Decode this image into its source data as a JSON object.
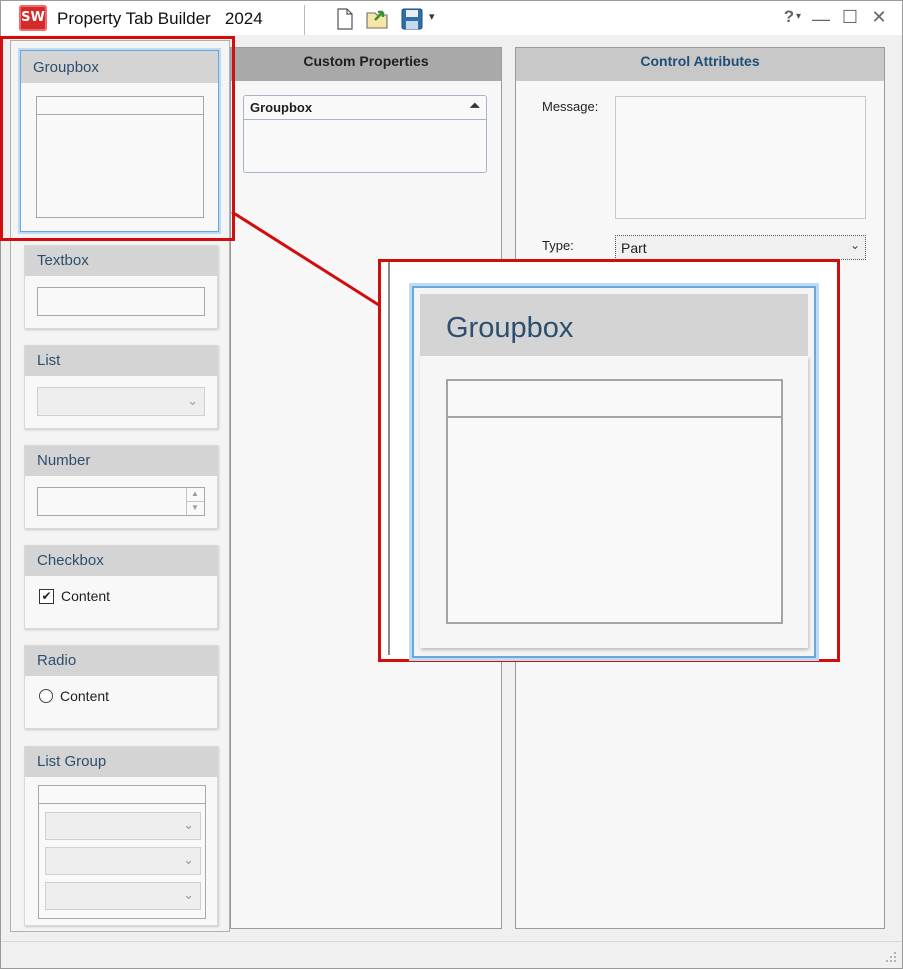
{
  "app": {
    "title": "Property Tab Builder",
    "version": "2024",
    "logo_text": "SW",
    "help_label": "?",
    "help_dropdown": "▾",
    "save_dropdown": "▾",
    "minimize": "—",
    "maximize": "☐",
    "close": "✕"
  },
  "palette": {
    "groupbox": {
      "label": "Groupbox"
    },
    "textbox": {
      "label": "Textbox"
    },
    "list": {
      "label": "List"
    },
    "number": {
      "label": "Number",
      "up": "▲",
      "down": "▼"
    },
    "checkbox": {
      "label": "Checkbox",
      "mark": "✔",
      "content": "Content"
    },
    "radio": {
      "label": "Radio",
      "content": "Content"
    },
    "list_group": {
      "label": "List Group"
    },
    "chevron": "⌄"
  },
  "custom_properties": {
    "header": "Custom Properties",
    "groupbox_title": "Groupbox",
    "collapse_icon": "⏶"
  },
  "control_attributes": {
    "header": "Control Attributes",
    "message_label": "Message:",
    "message_value": "",
    "type_label": "Type:",
    "type_value": "Part"
  },
  "zoom_callout": {
    "label": "Groupbox"
  },
  "colors": {
    "highlight_red": "#d10d0d",
    "selection_blue": "#5aa0d8",
    "card_header": "#d4d4d4",
    "header_text_blue": "#1f4e79"
  }
}
